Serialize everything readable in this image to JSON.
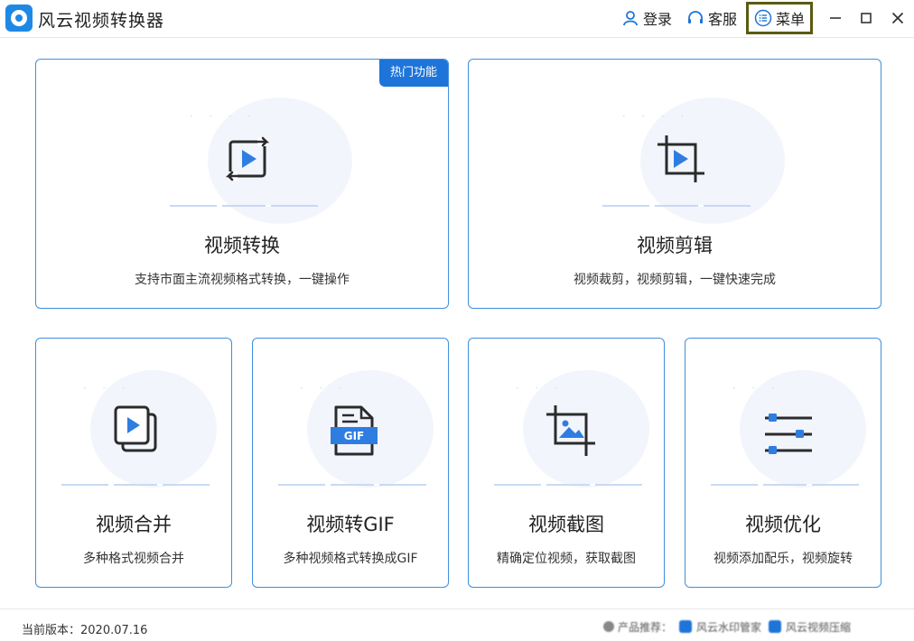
{
  "app": {
    "title": "风云视频转换器"
  },
  "titlebar": {
    "login_label": "登录",
    "service_label": "客服",
    "menu_label": "菜单"
  },
  "cards": [
    {
      "title": "视频转换",
      "desc": "支持市面主流视频格式转换，一键操作",
      "badge": "热门功能",
      "icon": "convert-icon"
    },
    {
      "title": "视频剪辑",
      "desc": "视频裁剪，视频剪辑，一键快速完成",
      "icon": "crop-video-icon"
    },
    {
      "title": "视频合并",
      "desc": "多种格式视频合并",
      "icon": "merge-video-icon"
    },
    {
      "title": "视频转GIF",
      "desc": "多种视频格式转换成GIF",
      "icon": "gif-icon",
      "icon_text": "GIF"
    },
    {
      "title": "视频截图",
      "desc": "精确定位视频，获取截图",
      "icon": "screenshot-icon"
    },
    {
      "title": "视频优化",
      "desc": "视频添加配乐，视频旋转",
      "icon": "optimize-icon"
    }
  ],
  "footer": {
    "version": "当前版本：2020.07.16",
    "recommend_label": "产品推荐：",
    "product_1": "风云水印管家",
    "product_2": "风云视频压缩"
  },
  "colors": {
    "accent": "#1e74d8",
    "card_border": "#3f8fdc",
    "menu_highlight": "#5b5a12"
  }
}
